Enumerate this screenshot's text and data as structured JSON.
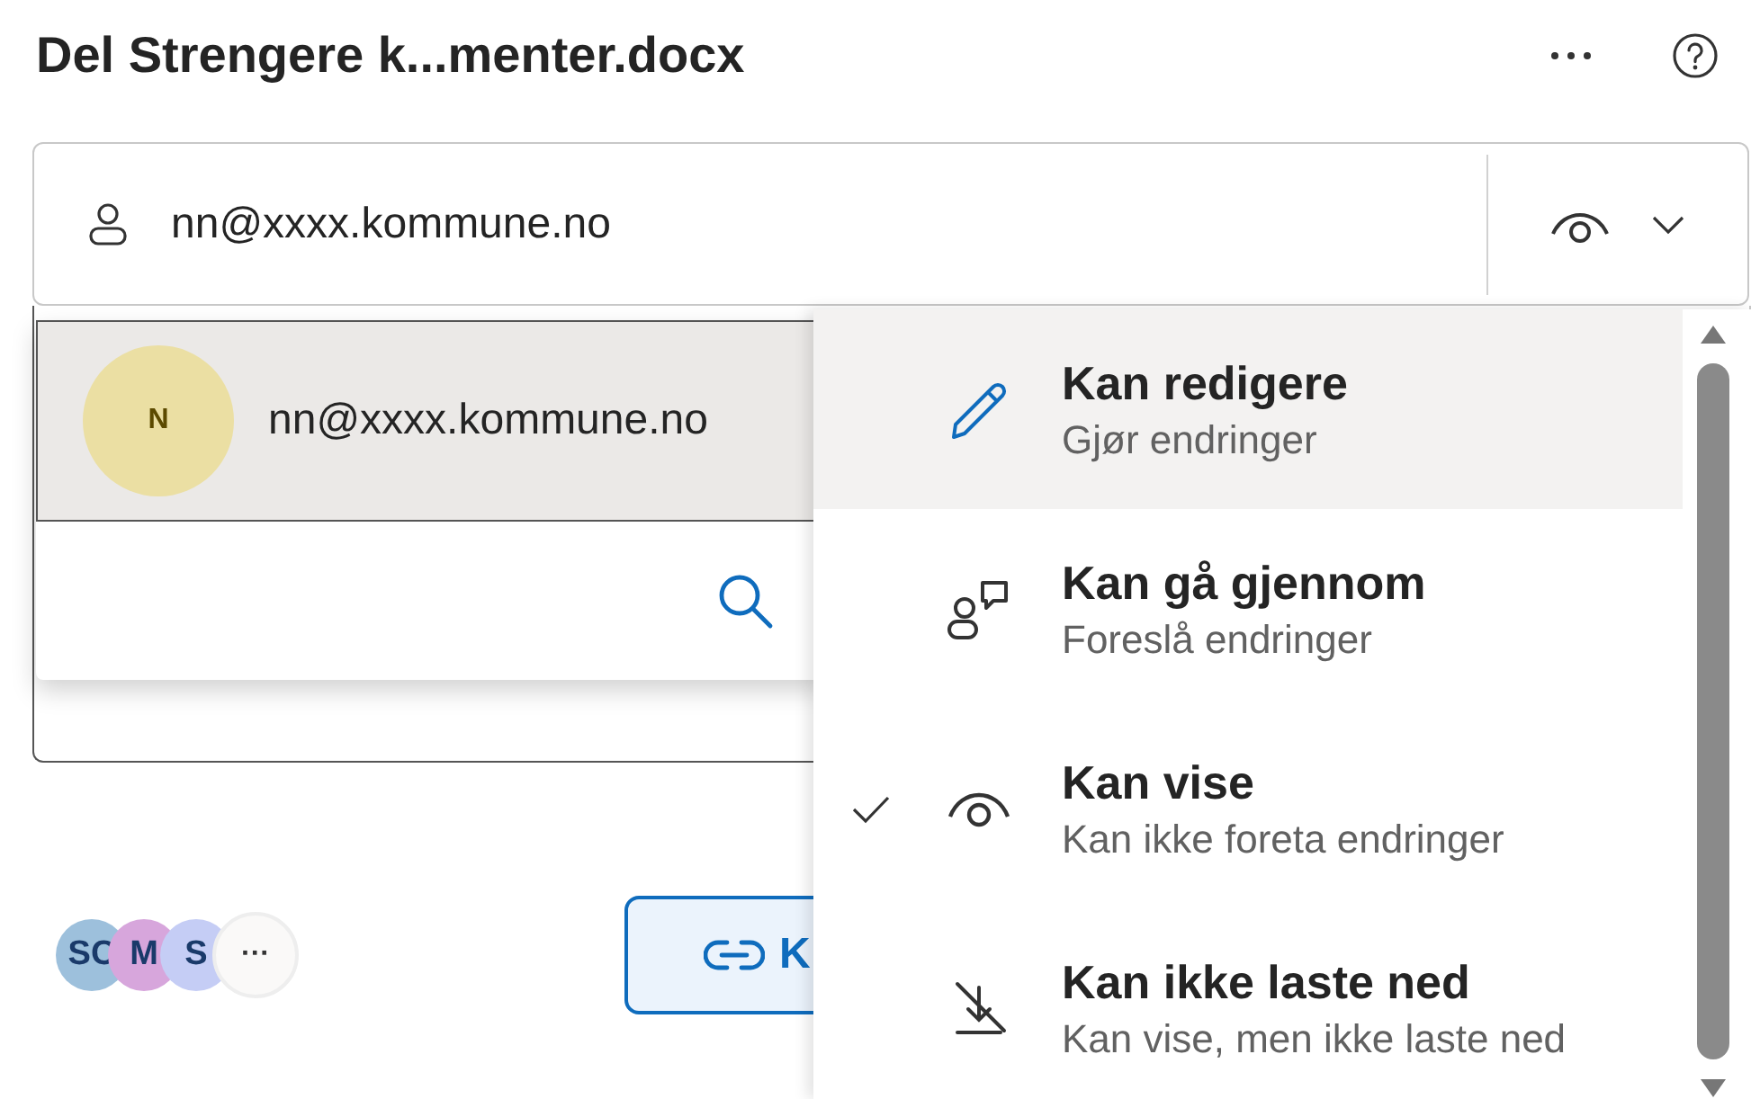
{
  "title": "Del Strengere k...menter.docx",
  "recipient_field": {
    "value": "nn@xxxx.kommune.no"
  },
  "suggestion": {
    "initial": "N",
    "color": "#ebdfa3",
    "email": "nn@xxxx.kommune.no"
  },
  "shared_with": [
    {
      "initials": "SC",
      "color": "#9dc0dc"
    },
    {
      "initials": "M",
      "color": "#d7a6dc"
    },
    {
      "initials": "S",
      "color": "#c5cdf5"
    }
  ],
  "more_people": "···",
  "copy_link_button": "K",
  "permission_menu": [
    {
      "kind": "edit",
      "title": "Kan redigere",
      "subtitle": "Gjør endringer",
      "highlighted": true,
      "checked": false
    },
    {
      "kind": "review",
      "title": "Kan gå gjennom",
      "subtitle": "Foreslå endringer",
      "highlighted": false,
      "checked": false
    },
    {
      "kind": "view",
      "title": "Kan vise",
      "subtitle": "Kan ikke foreta endringer",
      "highlighted": false,
      "checked": true
    },
    {
      "kind": "no-download",
      "title": "Kan ikke laste ned",
      "subtitle": "Kan vise, men ikke laste ned",
      "highlighted": false,
      "checked": false
    }
  ]
}
